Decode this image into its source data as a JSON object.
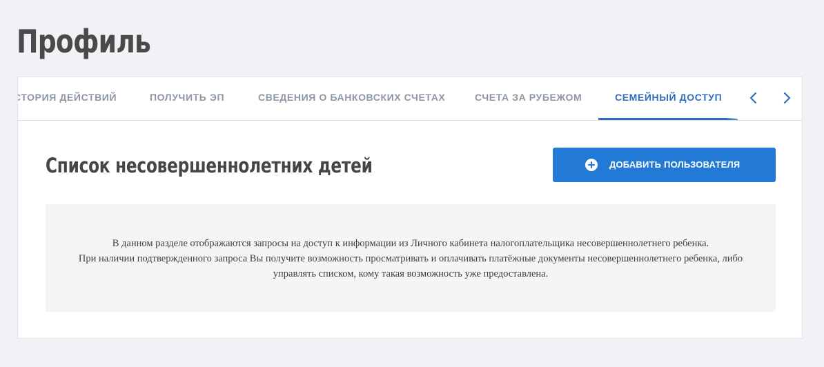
{
  "page": {
    "title": "Профиль"
  },
  "tabs": {
    "items": [
      {
        "label": "СТОРИЯ ДЕЙСТВИЙ"
      },
      {
        "label": "ПОЛУЧИТЬ ЭП"
      },
      {
        "label": "СВЕДЕНИЯ О БАНКОВСКИХ СЧЕТАХ"
      },
      {
        "label": "СЧЕТА ЗА РУБЕЖОМ"
      },
      {
        "label": "СЕМЕЙНЫЙ ДОСТУП",
        "active": true
      }
    ],
    "prev_icon": "chevron-left-icon",
    "next_icon": "chevron-right-icon"
  },
  "section": {
    "title": "Список несовершеннолетних детей",
    "add_button_label": "ДОБАВИТЬ ПОЛЬЗОВАТЕЛЯ",
    "add_button_icon": "plus-circle-icon"
  },
  "info": {
    "line1": "В данном разделе отображаются запросы на доступ к информации из Личного кабинета налогоплательщика несовершеннолетнего ребенка.",
    "line2": "При наличии подтвержденного запроса Вы получите возможность просматривать и оплачивать платёжные документы несовершеннолетнего ребенка, либо управлять списком, кому такая возможность уже предоставлена."
  },
  "colors": {
    "background": "#f0f2f6",
    "accent": "#2379d6",
    "active_tab": "#2f6fbe",
    "inactive_tab": "#8c96a4",
    "title_text": "#454545"
  }
}
